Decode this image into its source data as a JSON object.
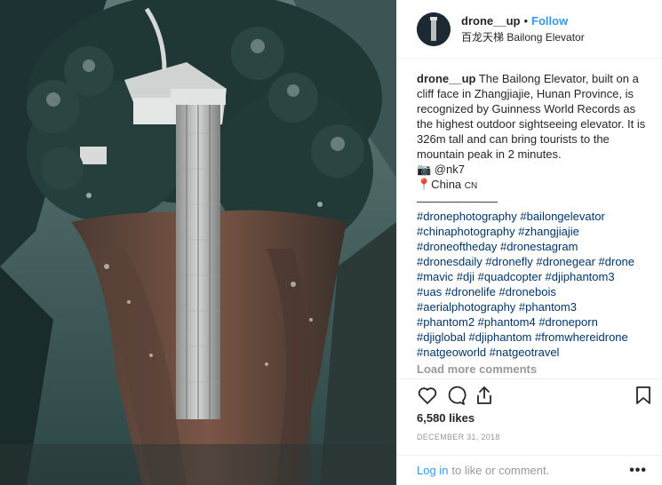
{
  "photo": {
    "alt_icon": "bailong-elevator-photo"
  },
  "header": {
    "username": "drone__up",
    "separator": "•",
    "follow_label": "Follow",
    "location": "百龙天梯 Bailong Elevator"
  },
  "caption": {
    "username": "drone__up",
    "text": "The Bailong Elevator, built on a cliff face in Zhangjiajie, Hunan Province, is recognized by Guinness World Records as the highest outdoor sightseeing elevator. It is 326m tall and can bring tourists to the mountain peak in 2 minutes.",
    "credit": "📷 @nk7",
    "place": "📍China",
    "place_code": "CN",
    "divider": "———————",
    "hashtag_lines": [
      "#dronephotography #bailongelevator",
      "#chinaphotography #zhangjiajie",
      "#droneoftheday #dronestagram",
      "#dronesdaily #dronefly #dronegear #drone",
      "#mavic #dji #quadcopter #djiphantom3",
      "#uas #dronelife #dronebois",
      "#aerialphotography #phantom3",
      "#phantom2 #phantom4 #droneporn",
      "#djiglobal #djiphantom #fromwhereidrone",
      "#natgeoworld #natgeotravel"
    ],
    "load_more": "Load more comments"
  },
  "actions": {
    "like_icon": "heart-icon",
    "comment_icon": "comment-icon",
    "share_icon": "share-icon",
    "save_icon": "bookmark-icon"
  },
  "likes": "6,580 likes",
  "date": "DECEMBER 31, 2018",
  "footer": {
    "login_label": "Log in",
    "login_rest": "to like or comment.",
    "more_label": "•••"
  }
}
